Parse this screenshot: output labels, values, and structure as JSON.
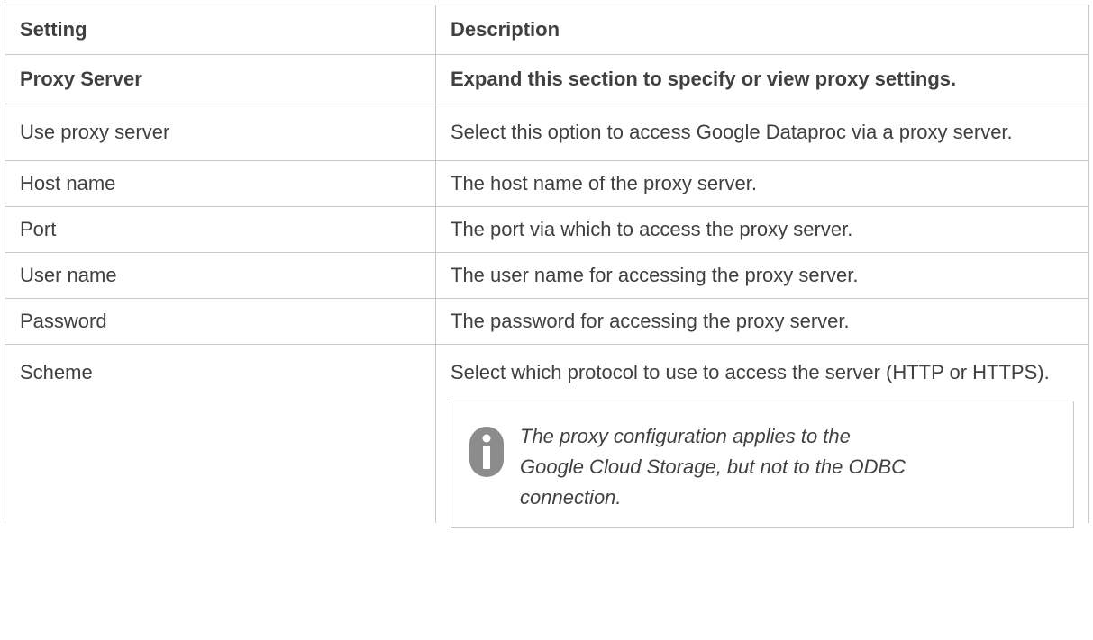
{
  "table": {
    "headers": {
      "setting": "Setting",
      "description": "Description"
    },
    "section": {
      "setting": "Proxy Server",
      "description": "Expand this section to specify or view proxy settings."
    },
    "rows": [
      {
        "setting": "Use proxy server",
        "description": "Select this option to access Google Dataproc via a proxy server."
      },
      {
        "setting": "Host name",
        "description": "The host name of the proxy server."
      },
      {
        "setting": "Port",
        "description": "The port via which to access the proxy server."
      },
      {
        "setting": "User name",
        "description": "The user name for accessing the proxy server."
      },
      {
        "setting": "Password",
        "description": "The password for accessing the proxy server."
      },
      {
        "setting": "Scheme",
        "description": "Select which protocol to use to access the server (HTTP or HTTPS)."
      }
    ],
    "note": {
      "icon": "info-icon",
      "text": "The proxy configuration applies to the Google Cloud Storage, but not to the ODBC connection."
    }
  },
  "colors": {
    "border": "#c8c8c8",
    "text": "#404040",
    "icon": "#8c8c8c"
  }
}
